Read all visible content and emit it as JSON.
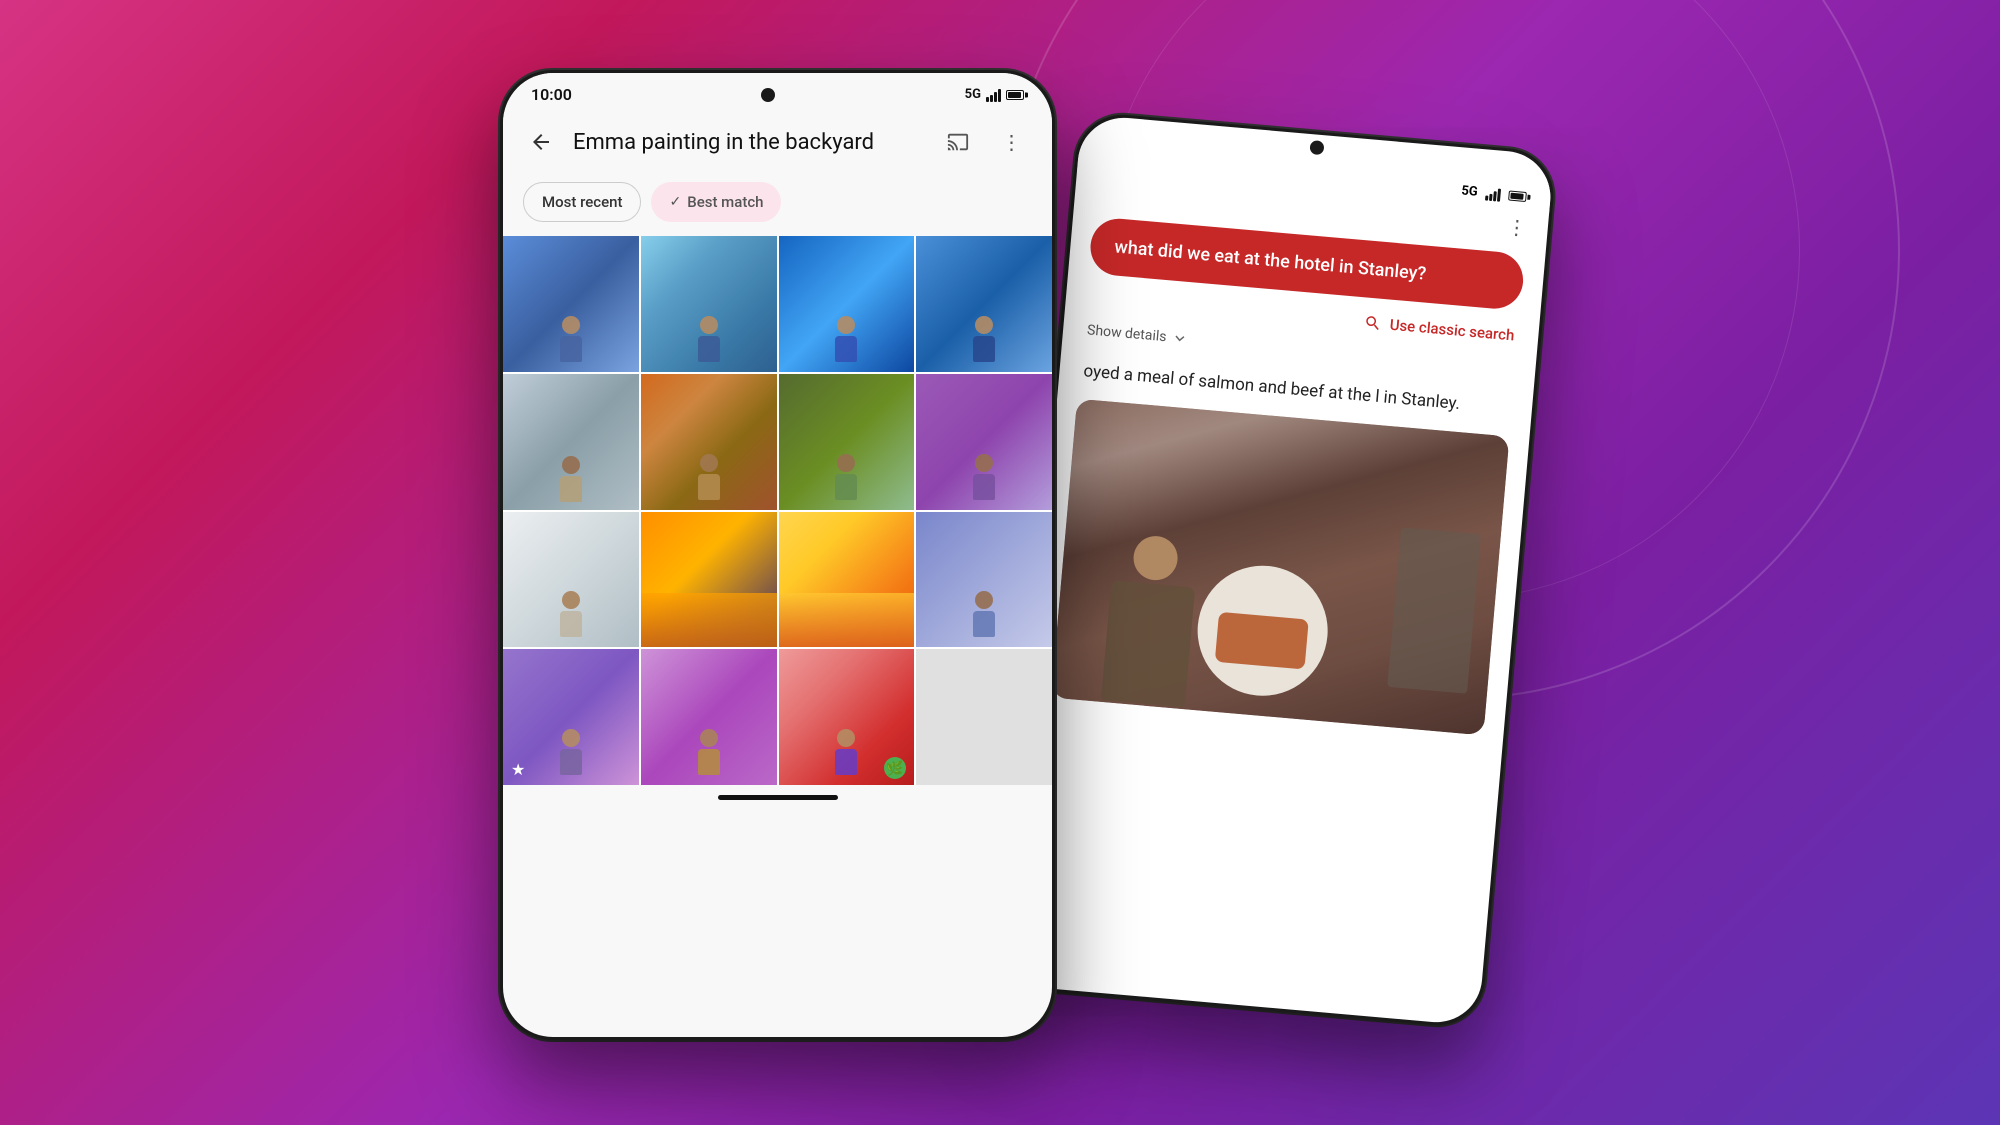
{
  "background": {
    "gradient": "linear-gradient(135deg, #d63384 0%, #c2185b 20%, #9c27b0 50%, #7b1fa2 70%, #5c35b5 100%)"
  },
  "phone_left": {
    "status": {
      "time": "10:00",
      "network": "5G",
      "signal": "full",
      "battery": "full"
    },
    "app_bar": {
      "back_label": "←",
      "title": "Emma painting in the backyard",
      "cast_label": "cast",
      "more_label": "⋮"
    },
    "filters": {
      "most_recent_label": "Most recent",
      "best_match_label": "Best match",
      "best_match_active": true
    },
    "photo_grid": {
      "rows": 4,
      "cols": 4,
      "total_photos": 15
    }
  },
  "phone_right": {
    "status": {
      "network": "5G",
      "signal": "full",
      "battery": "full"
    },
    "more_label": "⋮",
    "query": {
      "text": "what did we eat at the hotel in Stanley?"
    },
    "classic_search": {
      "label": "Use classic search",
      "icon": "search"
    },
    "show_details": {
      "label": "Show details",
      "icon": "chevron-down"
    },
    "response": {
      "text": "oyed a meal of salmon and beef at the l in Stanley."
    }
  }
}
